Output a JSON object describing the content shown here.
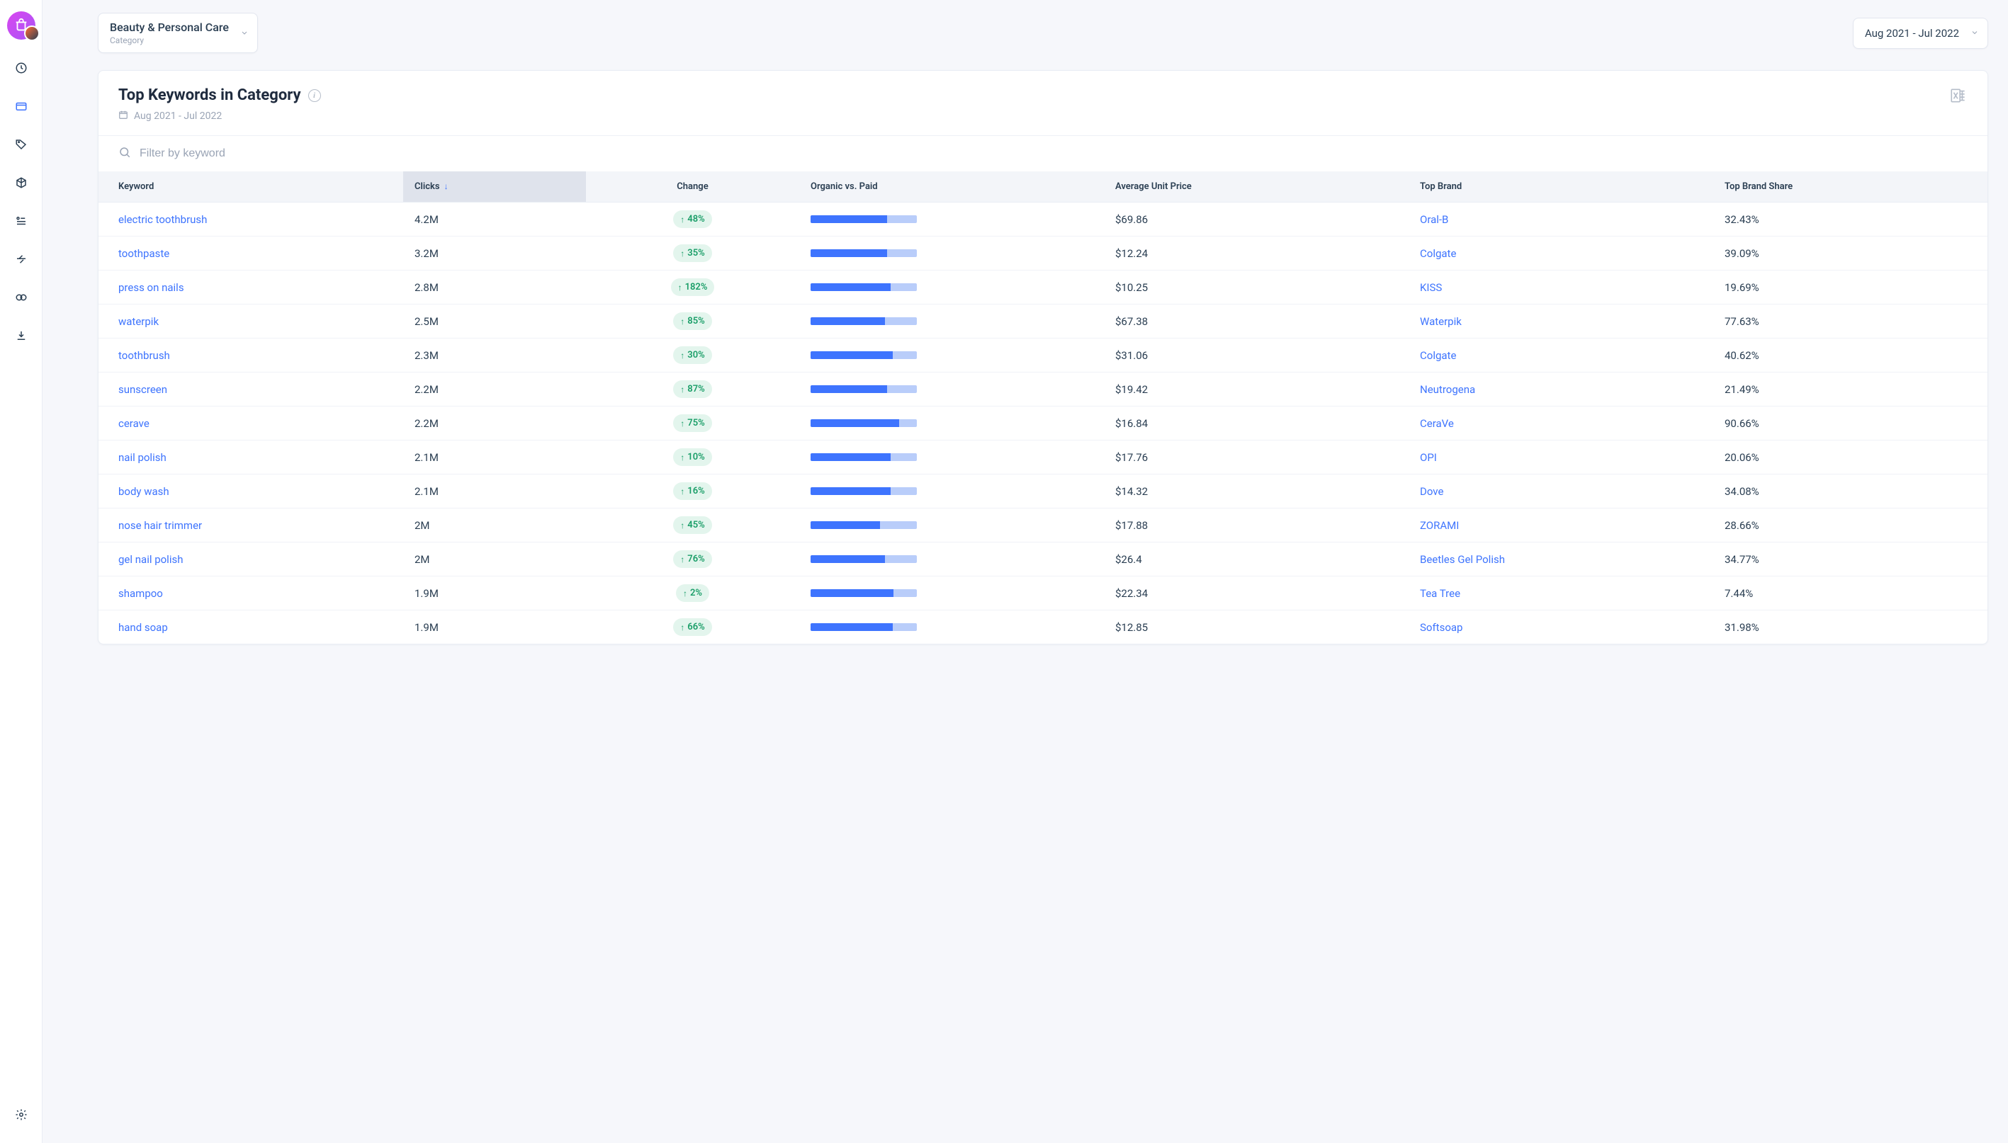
{
  "categorySelect": {
    "title": "Beauty & Personal Care",
    "subtitle": "Category"
  },
  "dateSelect": {
    "label": "Aug 2021 - Jul 2022"
  },
  "card": {
    "title": "Top Keywords in Category",
    "dateRange": "Aug 2021 - Jul 2022",
    "filterPlaceholder": "Filter by keyword"
  },
  "columns": {
    "keyword": "Keyword",
    "clicks": "Clicks",
    "change": "Change",
    "organicVsPaid": "Organic vs. Paid",
    "avgPrice": "Average Unit Price",
    "topBrand": "Top Brand",
    "topBrandShare": "Top Brand Share"
  },
  "rows": [
    {
      "keyword": "electric toothbrush",
      "clicks": "4.2M",
      "change": "48%",
      "organicPct": 72,
      "price": "$69.86",
      "brand": "Oral-B",
      "share": "32.43%"
    },
    {
      "keyword": "toothpaste",
      "clicks": "3.2M",
      "change": "35%",
      "organicPct": 72,
      "price": "$12.24",
      "brand": "Colgate",
      "share": "39.09%"
    },
    {
      "keyword": "press on nails",
      "clicks": "2.8M",
      "change": "182%",
      "organicPct": 75,
      "price": "$10.25",
      "brand": "KISS",
      "share": "19.69%"
    },
    {
      "keyword": "waterpik",
      "clicks": "2.5M",
      "change": "85%",
      "organicPct": 70,
      "price": "$67.38",
      "brand": "Waterpik",
      "share": "77.63%"
    },
    {
      "keyword": "toothbrush",
      "clicks": "2.3M",
      "change": "30%",
      "organicPct": 77,
      "price": "$31.06",
      "brand": "Colgate",
      "share": "40.62%"
    },
    {
      "keyword": "sunscreen",
      "clicks": "2.2M",
      "change": "87%",
      "organicPct": 72,
      "price": "$19.42",
      "brand": "Neutrogena",
      "share": "21.49%"
    },
    {
      "keyword": "cerave",
      "clicks": "2.2M",
      "change": "75%",
      "organicPct": 83,
      "price": "$16.84",
      "brand": "CeraVe",
      "share": "90.66%"
    },
    {
      "keyword": "nail polish",
      "clicks": "2.1M",
      "change": "10%",
      "organicPct": 75,
      "price": "$17.76",
      "brand": "OPI",
      "share": "20.06%"
    },
    {
      "keyword": "body wash",
      "clicks": "2.1M",
      "change": "16%",
      "organicPct": 75,
      "price": "$14.32",
      "brand": "Dove",
      "share": "34.08%"
    },
    {
      "keyword": "nose hair trimmer",
      "clicks": "2M",
      "change": "45%",
      "organicPct": 65,
      "price": "$17.88",
      "brand": "ZORAMI",
      "share": "28.66%"
    },
    {
      "keyword": "gel nail polish",
      "clicks": "2M",
      "change": "76%",
      "organicPct": 70,
      "price": "$26.4",
      "brand": "Beetles Gel Polish",
      "share": "34.77%"
    },
    {
      "keyword": "shampoo",
      "clicks": "1.9M",
      "change": "2%",
      "organicPct": 78,
      "price": "$22.34",
      "brand": "Tea Tree",
      "share": "7.44%"
    },
    {
      "keyword": "hand soap",
      "clicks": "1.9M",
      "change": "66%",
      "organicPct": 77,
      "price": "$12.85",
      "brand": "Softsoap",
      "share": "31.98%"
    }
  ]
}
